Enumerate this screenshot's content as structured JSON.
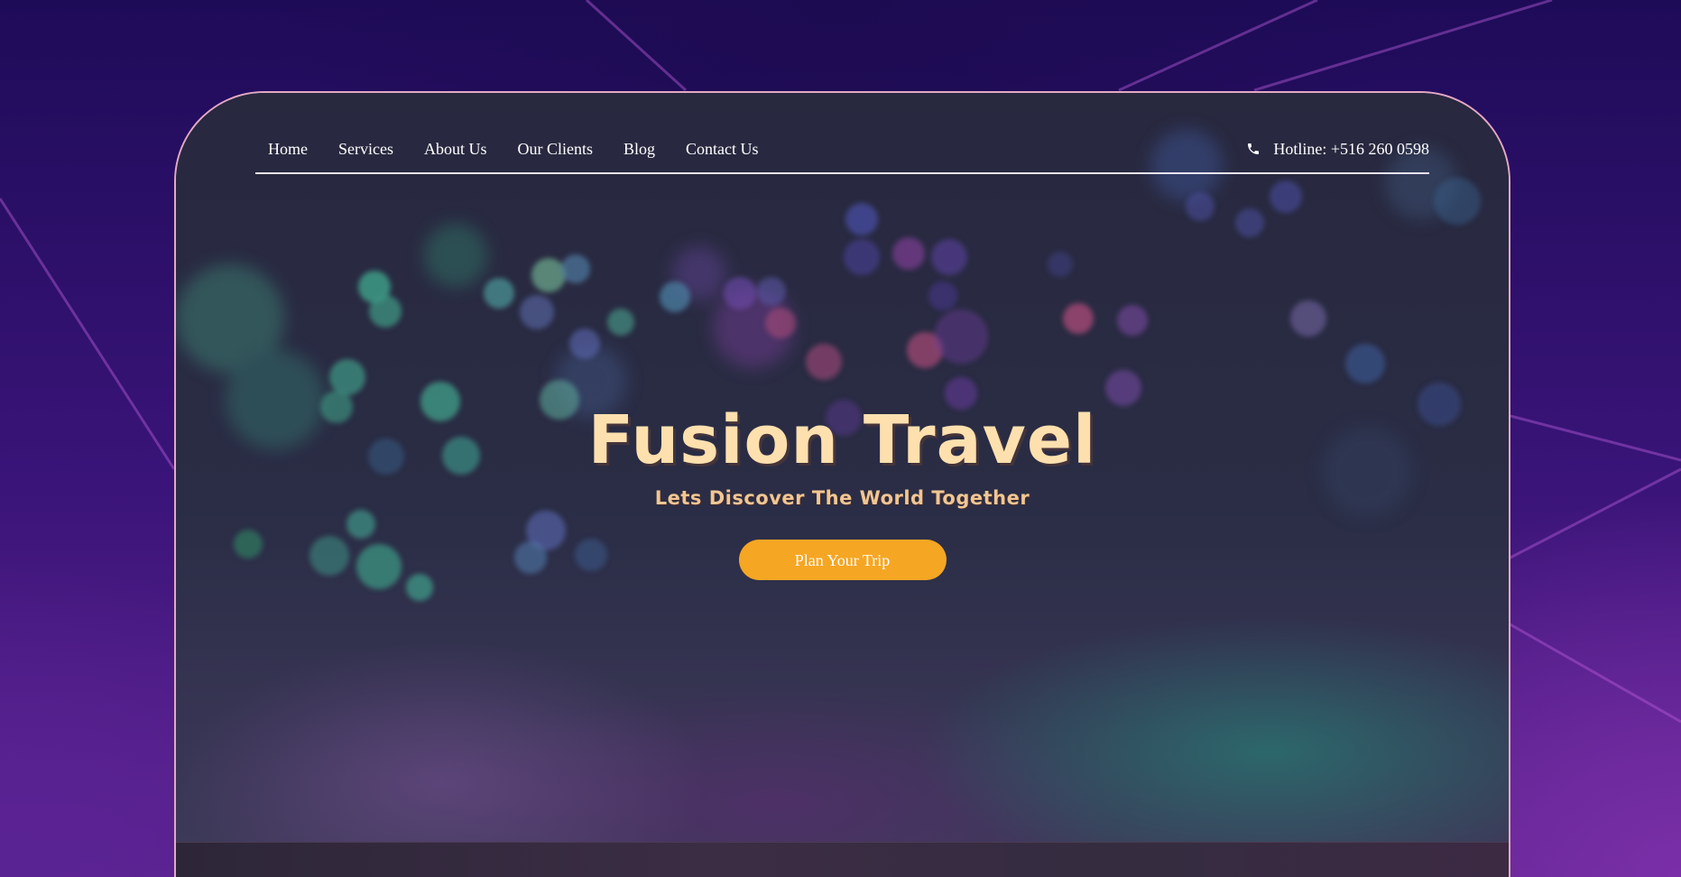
{
  "nav": {
    "items": [
      {
        "label": "Home"
      },
      {
        "label": "Services"
      },
      {
        "label": "About Us"
      },
      {
        "label": "Our Clients"
      },
      {
        "label": "Blog"
      },
      {
        "label": "Contact Us"
      }
    ],
    "hotline": "Hotline: +516 260 0598",
    "hotline_icon": "phone-icon"
  },
  "hero": {
    "title": "Fusion Travel",
    "subtitle": "Lets Discover The World Together",
    "cta_label": "Plan Your Trip"
  },
  "colors": {
    "accent": "#f5a623",
    "title": "#fde0ae",
    "subtitle": "#f0c693",
    "card_border": "#e4a9c3",
    "background": "#2a0e63"
  }
}
